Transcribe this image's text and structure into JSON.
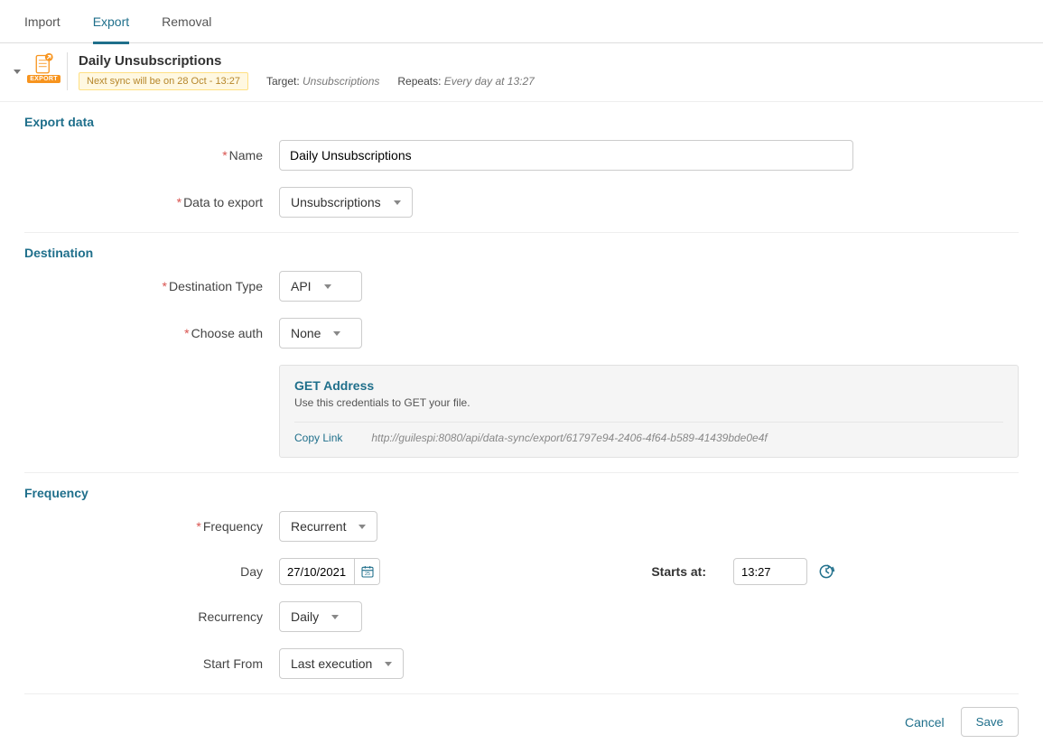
{
  "tabs": {
    "import": "Import",
    "export": "Export",
    "removal": "Removal",
    "active": "export"
  },
  "icon_badge": "EXPORT",
  "header": {
    "title": "Daily Unsubscriptions",
    "sync_badge": "Next sync will be on 28 Oct - 13:27",
    "target_label": "Target:",
    "target_value": "Unsubscriptions",
    "repeats_label": "Repeats:",
    "repeats_value": "Every day at 13:27"
  },
  "sections": {
    "export_data": "Export data",
    "destination": "Destination",
    "frequency": "Frequency"
  },
  "labels": {
    "name": "Name",
    "data_to_export": "Data to export",
    "destination_type": "Destination Type",
    "choose_auth": "Choose auth",
    "frequency": "Frequency",
    "day": "Day",
    "starts_at": "Starts at:",
    "recurrency": "Recurrency",
    "start_from": "Start From"
  },
  "values": {
    "name": "Daily Unsubscriptions",
    "data_to_export": "Unsubscriptions",
    "destination_type": "API",
    "choose_auth": "None",
    "frequency": "Recurrent",
    "day": "27/10/2021",
    "starts_at": "13:27",
    "recurrency": "Daily",
    "start_from": "Last execution"
  },
  "get_panel": {
    "title": "GET Address",
    "desc": "Use this credentials to GET your file.",
    "copy_link": "Copy Link",
    "url": "http://guilespi:8080/api/data-sync/export/61797e94-2406-4f64-b589-41439bde0e4f"
  },
  "footer": {
    "cancel": "Cancel",
    "save": "Save"
  }
}
